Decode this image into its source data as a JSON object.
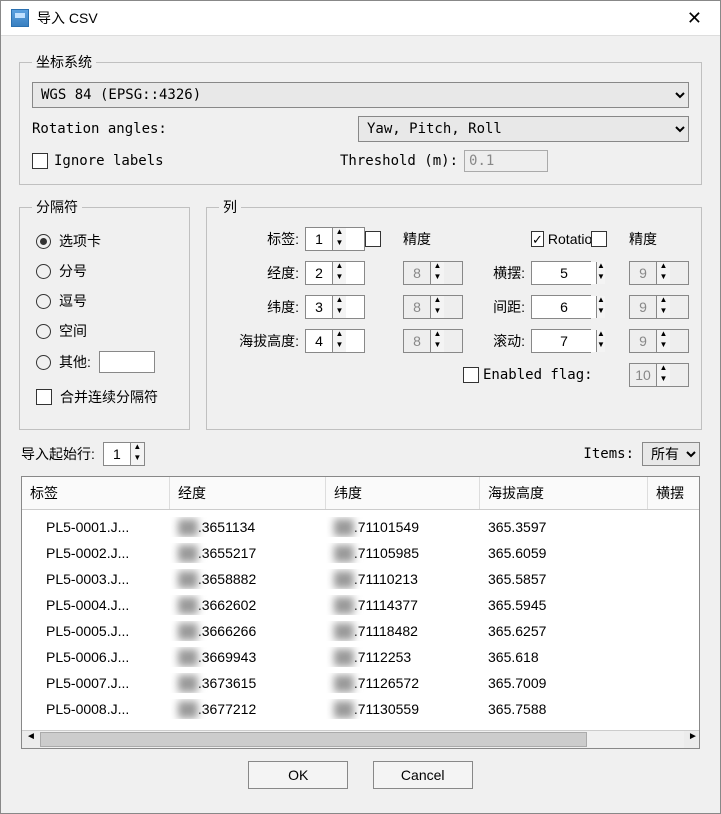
{
  "title": "导入 CSV",
  "coord": {
    "legend": "坐标系统",
    "crs": "WGS 84 (EPSG::4326)",
    "rotation_label": "Rotation angles:",
    "rotation_value": "Yaw, Pitch, Roll",
    "ignore_label": "Ignore labels",
    "threshold_label": "Threshold (m):",
    "threshold_value": "0.1"
  },
  "delim": {
    "legend": "分隔符",
    "tab": "选项卡",
    "semicolon": "分号",
    "comma": "逗号",
    "space": "空间",
    "other": "其他:",
    "merge": "合并连续分隔符"
  },
  "cols": {
    "legend": "列",
    "label": "标签:",
    "lon": "经度:",
    "lat": "纬度:",
    "alt": "海拔高度:",
    "prec": "精度",
    "rotation": "Rotation",
    "yaw": "横摆:",
    "pitch": "间距:",
    "roll": "滚动:",
    "enabled": "Enabled flag:",
    "v_label": "1",
    "v_lon": "2",
    "v_lat": "3",
    "v_alt": "4",
    "v_yaw": "5",
    "v_pitch": "6",
    "v_roll": "7",
    "p_lon": "8",
    "p_lat": "8",
    "p_alt": "8",
    "p_yaw": "9",
    "p_pitch": "9",
    "p_roll": "9",
    "v_enabled": "10"
  },
  "import_from": "导入起始行:",
  "import_from_v": "1",
  "items_label": "Items:",
  "items_value": "所有",
  "thead": [
    "标签",
    "经度",
    "纬度",
    "海拔高度",
    "横摆"
  ],
  "rows": [
    {
      "label": "PL5-0001.J...",
      "lon": ".3651134",
      "lat": ".71101549",
      "alt": "365.3597"
    },
    {
      "label": "PL5-0002.J...",
      "lon": ".3655217",
      "lat": ".71105985",
      "alt": "365.6059"
    },
    {
      "label": "PL5-0003.J...",
      "lon": ".3658882",
      "lat": ".71110213",
      "alt": "365.5857"
    },
    {
      "label": "PL5-0004.J...",
      "lon": ".3662602",
      "lat": ".71114377",
      "alt": "365.5945"
    },
    {
      "label": "PL5-0005.J...",
      "lon": ".3666266",
      "lat": ".71118482",
      "alt": "365.6257"
    },
    {
      "label": "PL5-0006.J...",
      "lon": ".3669943",
      "lat": ".7112253",
      "alt": "365.618"
    },
    {
      "label": "PL5-0007.J...",
      "lon": ".3673615",
      "lat": ".71126572",
      "alt": "365.7009"
    },
    {
      "label": "PL5-0008.J...",
      "lon": ".3677212",
      "lat": ".71130559",
      "alt": "365.7588"
    }
  ],
  "ok": "OK",
  "cancel": "Cancel"
}
